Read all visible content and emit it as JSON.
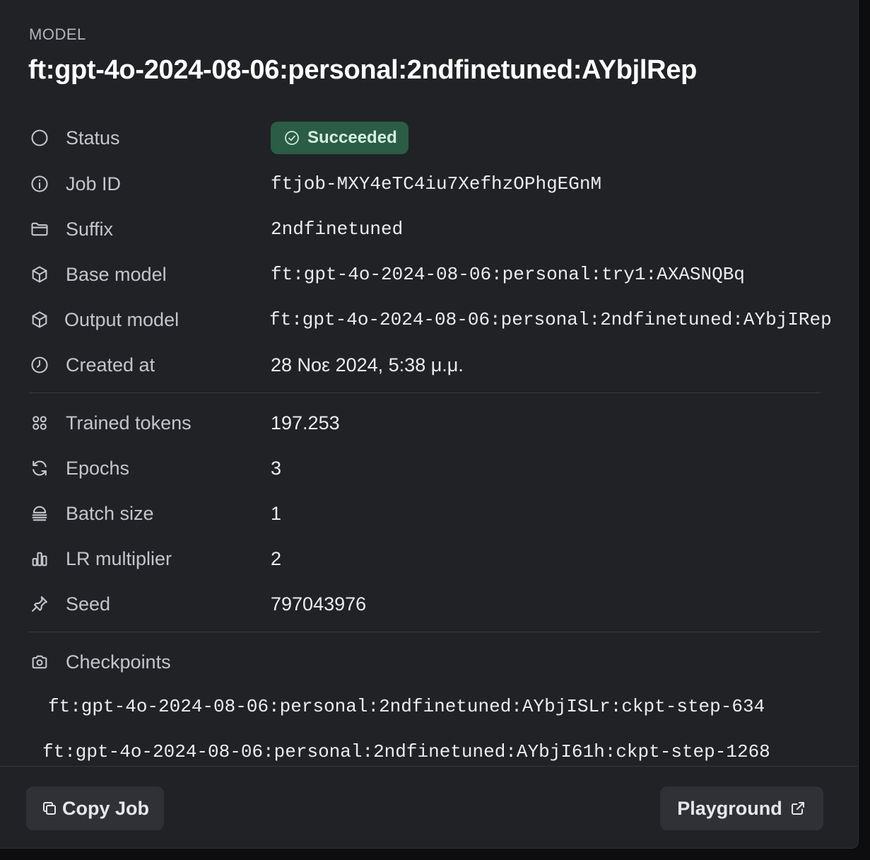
{
  "header": {
    "eyebrow": "MODEL",
    "title": "ft:gpt-4o-2024-08-06:personal:2ndfinetuned:AYbjlRep"
  },
  "status": {
    "label": "Status",
    "value": "Succeeded",
    "color": "#2b5c45"
  },
  "details": {
    "job_id": {
      "label": "Job ID",
      "value": "ftjob-MXY4eTC4iu7XefhzOPhgEGnM"
    },
    "suffix": {
      "label": "Suffix",
      "value": "2ndfinetuned"
    },
    "base_model": {
      "label": "Base model",
      "value": "ft:gpt-4o-2024-08-06:personal:try1:AXASNQBq"
    },
    "output_model": {
      "label": "Output model",
      "value": "ft:gpt-4o-2024-08-06:personal:2ndfinetuned:AYbjIRep"
    },
    "created_at": {
      "label": "Created at",
      "value": "28 Νοε 2024, 5:38 μ.μ."
    }
  },
  "hyperparams": {
    "trained_tokens": {
      "label": "Trained tokens",
      "value": "197.253"
    },
    "epochs": {
      "label": "Epochs",
      "value": "3"
    },
    "batch_size": {
      "label": "Batch size",
      "value": "1"
    },
    "lr_multiplier": {
      "label": "LR multiplier",
      "value": "2"
    },
    "seed": {
      "label": "Seed",
      "value": "797043976"
    }
  },
  "checkpoints": {
    "label": "Checkpoints",
    "items": [
      "ft:gpt-4o-2024-08-06:personal:2ndfinetuned:AYbjISLr:ckpt-step-634",
      "ft:gpt-4o-2024-08-06:personal:2ndfinetuned:AYbjI61h:ckpt-step-1268"
    ]
  },
  "footer": {
    "copy_label": "Copy Job",
    "playground_label": "Playground"
  }
}
